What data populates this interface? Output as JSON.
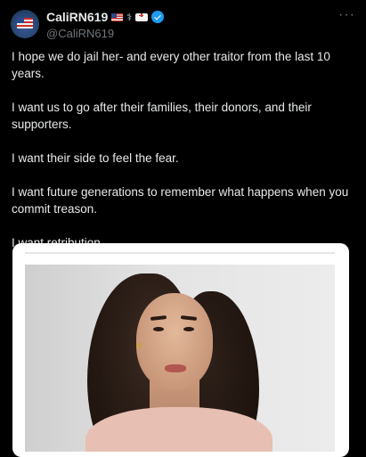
{
  "tweet": {
    "display_name": "CaliRN619",
    "handle": "@CaliRN619",
    "more_label": "···",
    "name_emojis": [
      "us-flag-icon",
      "stethoscope-icon",
      "ambulance-icon",
      "verified-badge-icon"
    ],
    "paragraphs": [
      "I hope we do jail her- and every other traitor from the last 10 years.",
      "I want us to go after their families, their donors, and their supporters.",
      "I want their side to feel the fear.",
      "I want future generations to remember what happens when you commit treason.",
      "I want retribution."
    ],
    "colors": {
      "background": "#000000",
      "text": "#e7e9ea",
      "secondary": "#71767b",
      "verified": "#1d9bf0"
    }
  }
}
